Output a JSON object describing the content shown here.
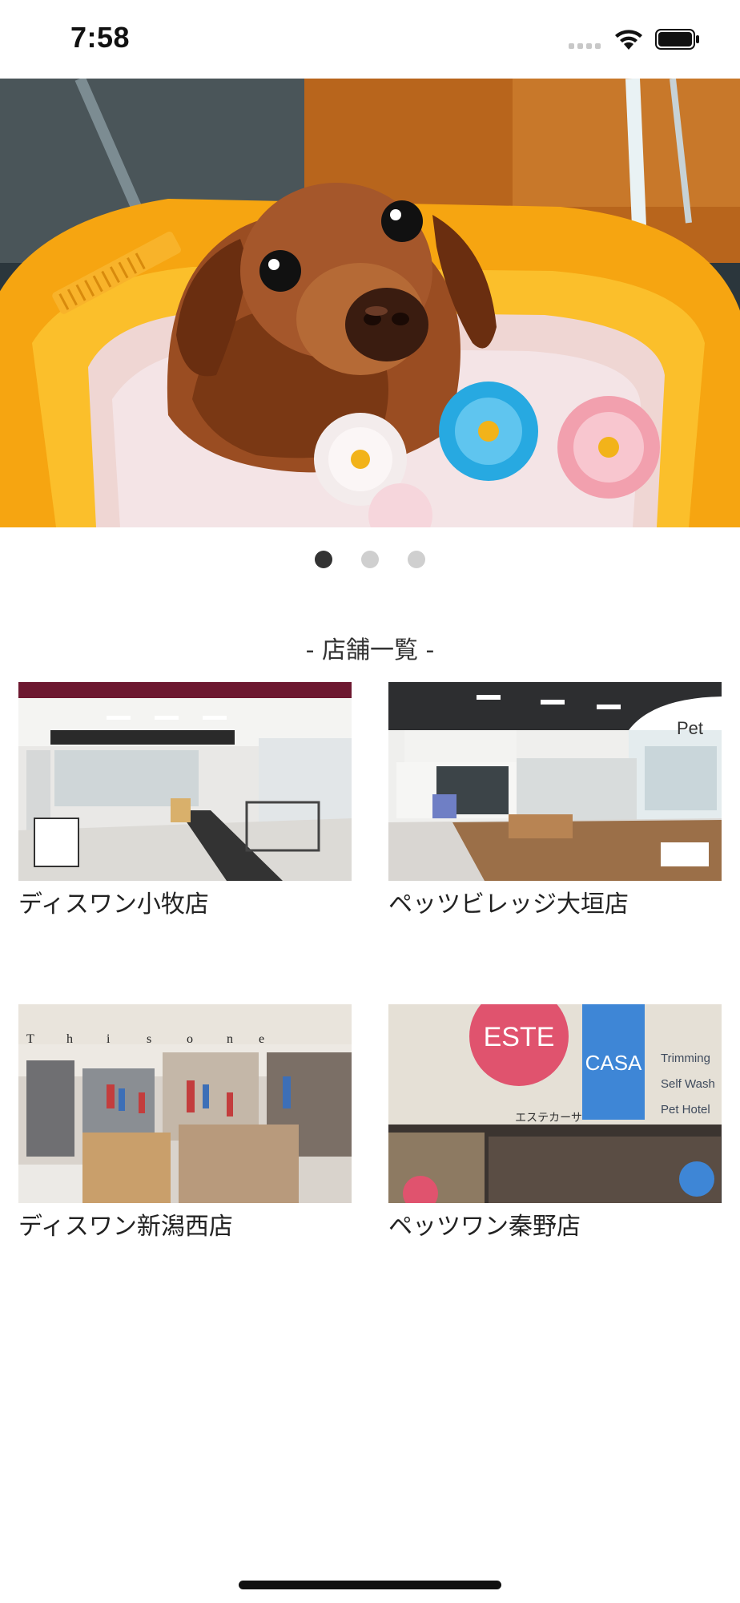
{
  "status_bar": {
    "time": "7:58"
  },
  "carousel": {
    "slide_count": 3,
    "active_index": 0
  },
  "section": {
    "title": "- 店舗一覧 -"
  },
  "stores": [
    {
      "name": "ディスワン小牧店"
    },
    {
      "name": "ペッツビレッジ大垣店"
    },
    {
      "name": "ディスワン新潟西店"
    },
    {
      "name": "ペッツワン秦野店",
      "signage": {
        "este": "ESTE",
        "casa": "CASA",
        "caption": "エステカーサ",
        "services": [
          "Trimming",
          "Self Wash",
          "Pet Hotel"
        ]
      }
    }
  ],
  "colors": {
    "dot_active": "#333333",
    "dot_inactive": "#cfcfcf",
    "tub": "#f6a511"
  }
}
